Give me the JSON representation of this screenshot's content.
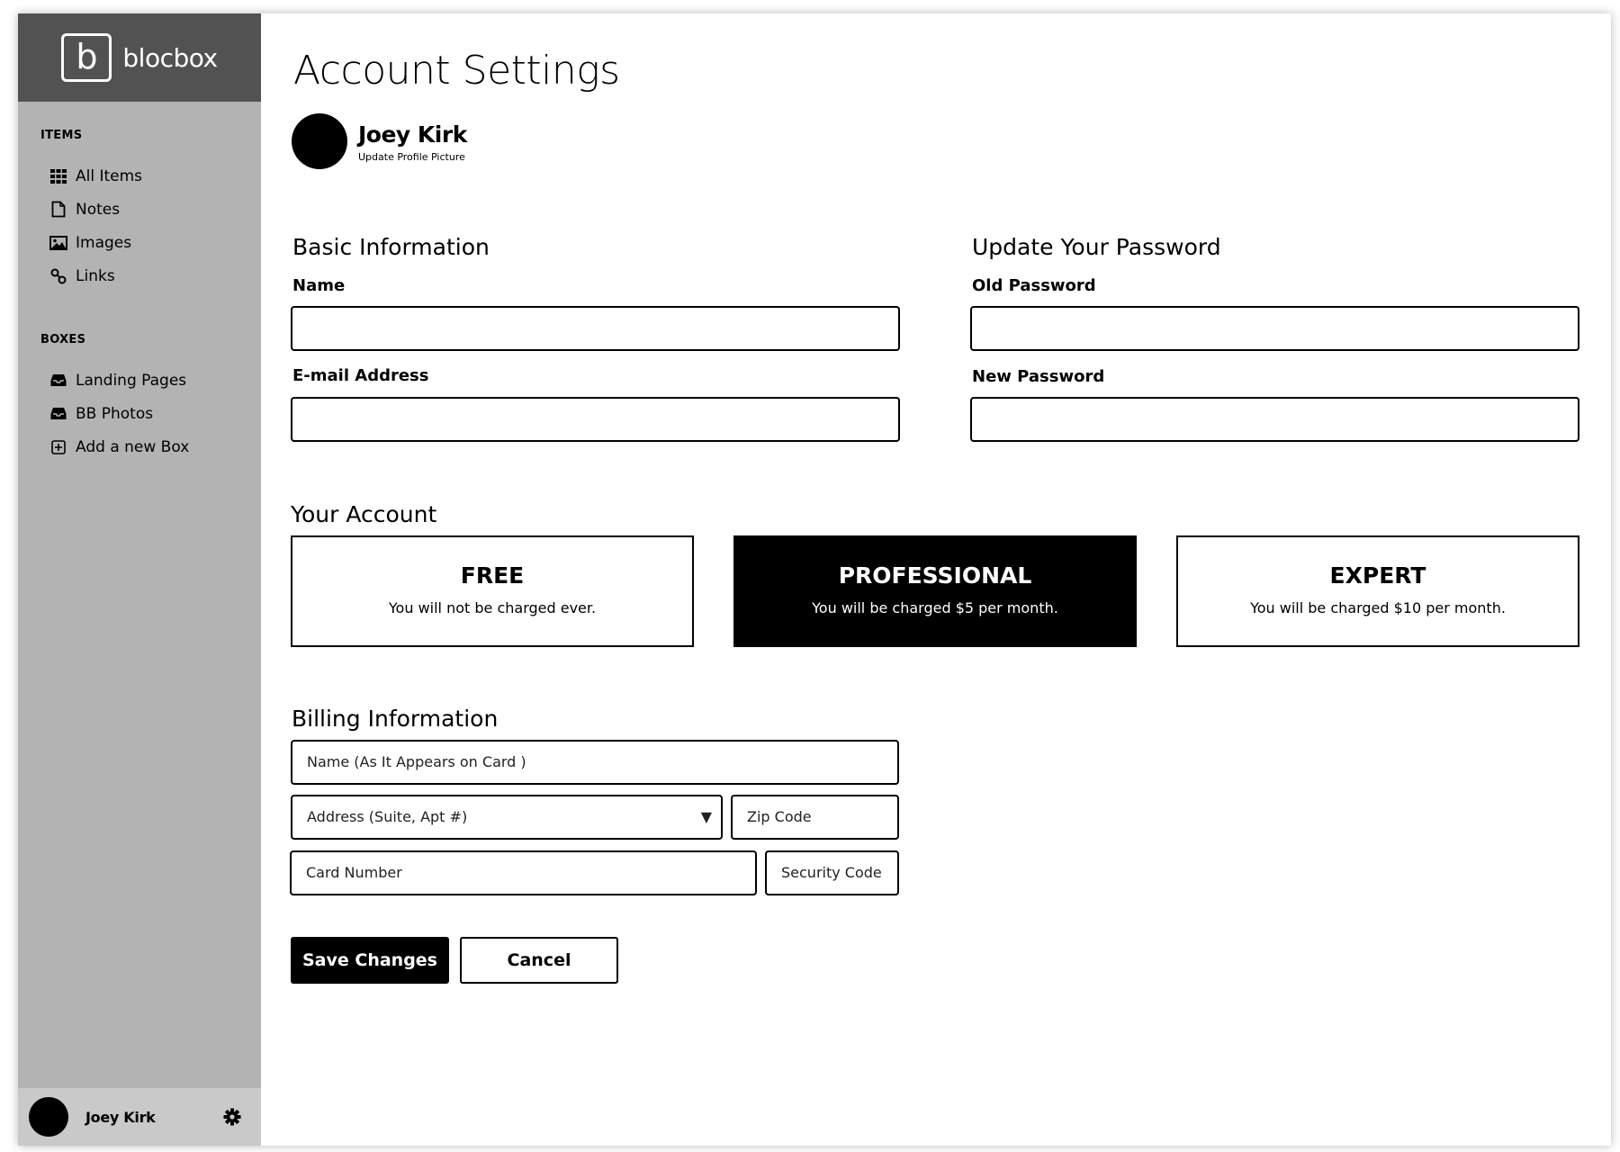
{
  "brand": {
    "logo_letter": "b",
    "name": "blocbox"
  },
  "sidebar": {
    "items_title": "ITEMS",
    "items": [
      {
        "label": "All Items",
        "icon": "grid-icon"
      },
      {
        "label": "Notes",
        "icon": "document-icon"
      },
      {
        "label": "Images",
        "icon": "image-icon"
      },
      {
        "label": "Links",
        "icon": "link-icon"
      }
    ],
    "boxes_title": "BOXES",
    "boxes": [
      {
        "label": "Landing Pages",
        "icon": "inbox-icon"
      },
      {
        "label": "BB Photos",
        "icon": "inbox-icon"
      },
      {
        "label": "Add a new Box",
        "icon": "plus-square-icon"
      }
    ],
    "user": {
      "name": "Joey Kirk",
      "settings_icon": "gear-icon"
    }
  },
  "page": {
    "title": "Account Settings",
    "profile": {
      "name": "Joey Kirk",
      "update_link": "Update Profile Picture"
    }
  },
  "basic_info": {
    "title": "Basic Information",
    "name_label": "Name",
    "name_value": "",
    "email_label": "E-mail Address",
    "email_value": ""
  },
  "password": {
    "title": "Update Your Password",
    "old_label": "Old Password",
    "new_label": "New Password"
  },
  "account": {
    "title": "Your Account",
    "plans": [
      {
        "name": "FREE",
        "desc": "You will not be charged ever.",
        "selected": false
      },
      {
        "name": "PROFESSIONAL",
        "desc": "You will be charged $5 per month.",
        "selected": true
      },
      {
        "name": "EXPERT",
        "desc": "You will be charged $10 per month.",
        "selected": false
      }
    ]
  },
  "billing": {
    "title": "Billing Information",
    "card_name_placeholder": "Name (As It Appears on Card )",
    "address_placeholder": "Address (Suite, Apt #)",
    "zip_placeholder": "Zip Code",
    "card_number_placeholder": "Card Number",
    "security_code_placeholder": "Security Code"
  },
  "actions": {
    "save_label": "Save Changes",
    "cancel_label": "Cancel"
  },
  "colors": {
    "sidebar_bg": "#b3b3b3",
    "brand_bg": "#525252",
    "user_bar_bg": "#c9c9c9",
    "accent": "#000000"
  }
}
